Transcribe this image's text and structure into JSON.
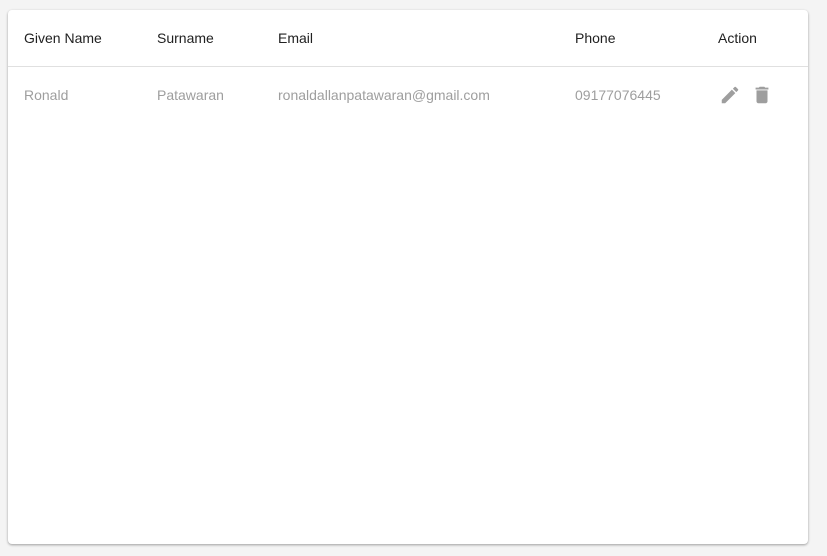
{
  "table": {
    "headers": {
      "given_name": "Given Name",
      "surname": "Surname",
      "email": "Email",
      "phone": "Phone",
      "action": "Action"
    },
    "rows": [
      {
        "given_name": "Ronald",
        "surname": "Patawaran",
        "email": "ronaldallanpatawaran@gmail.com",
        "phone": "09177076445",
        "actions": [
          "edit-icon",
          "delete-icon"
        ]
      }
    ]
  },
  "colors": {
    "header_text": "#212121",
    "cell_text": "#9e9e9e",
    "icon": "#9e9e9e",
    "divider": "#e0e0e0",
    "background": "#f4f4f4",
    "card": "#ffffff"
  }
}
